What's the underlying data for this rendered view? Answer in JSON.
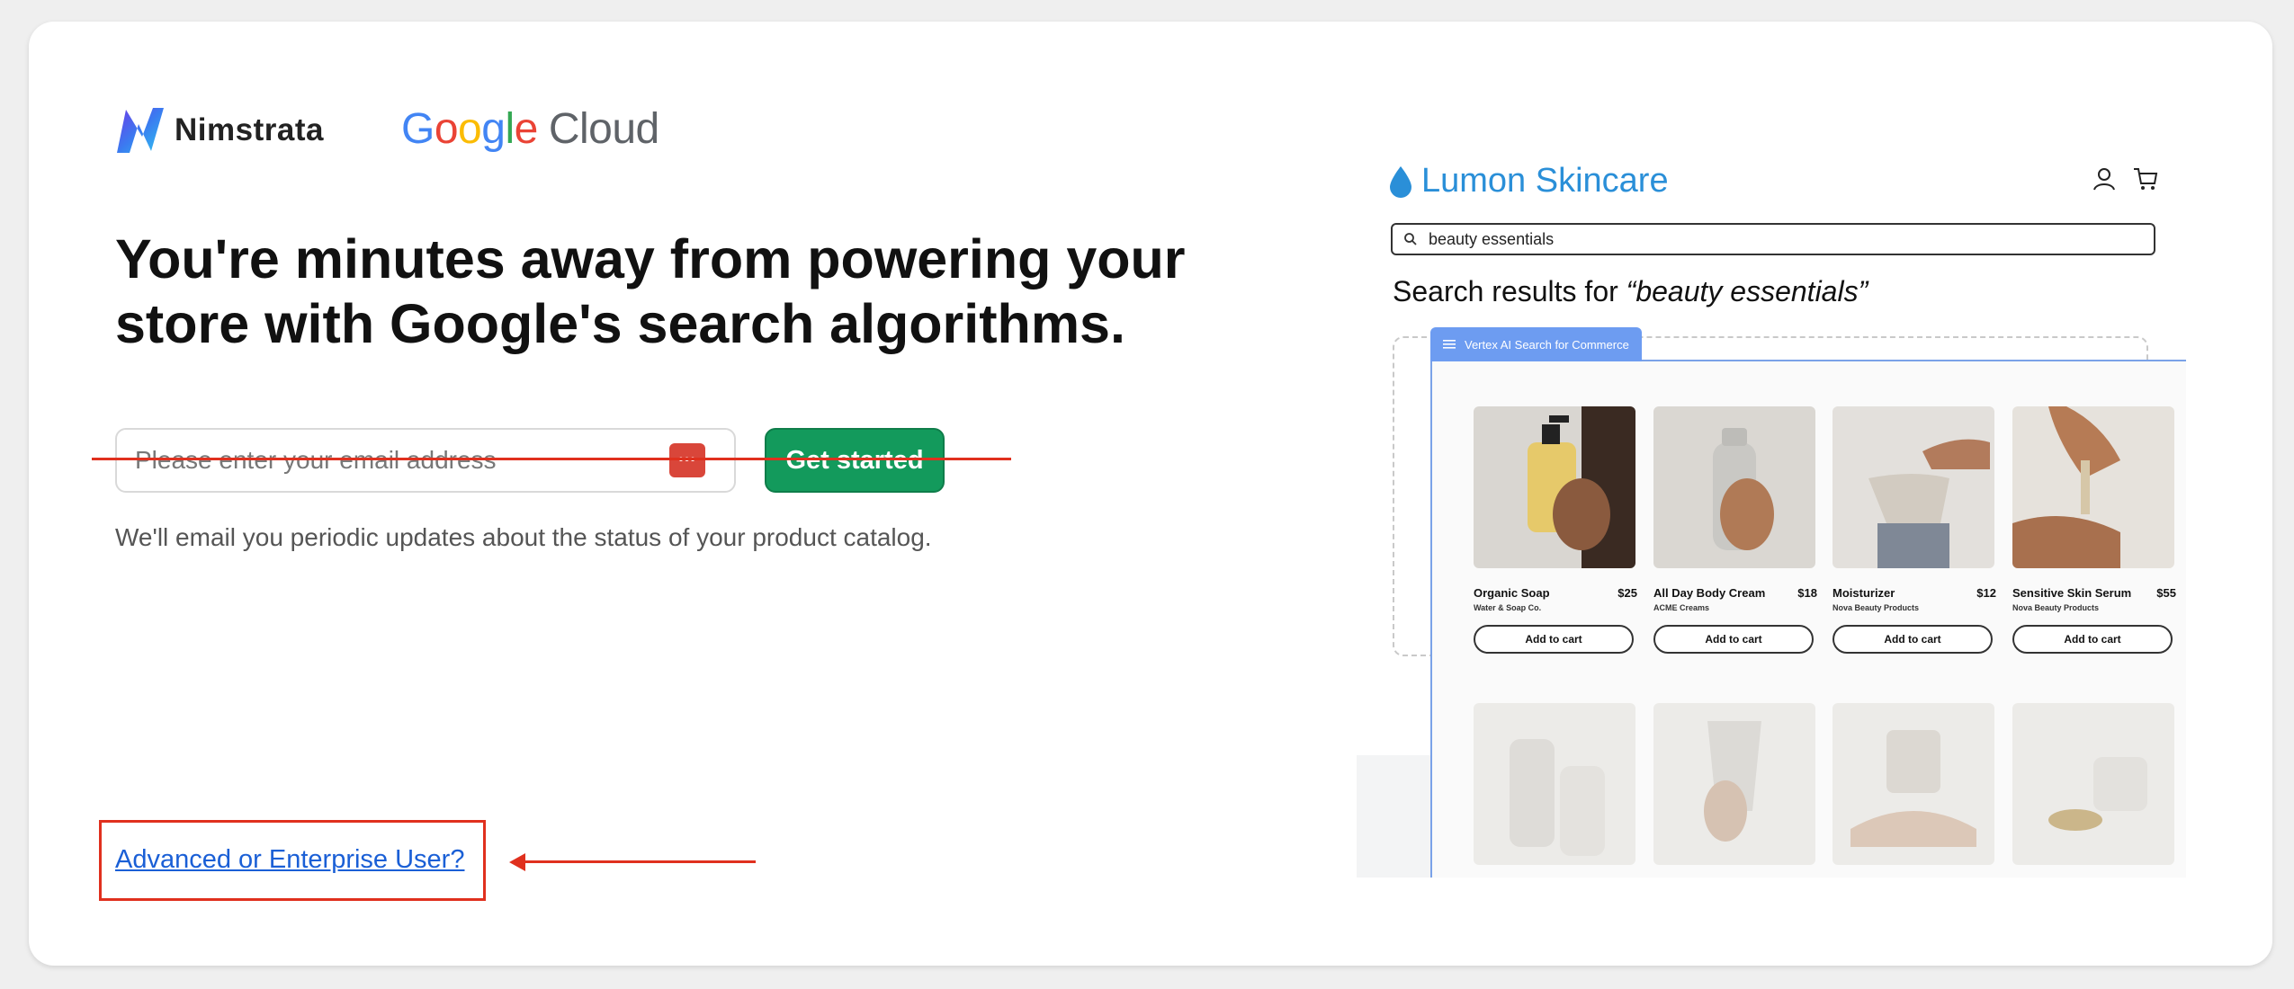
{
  "logos": {
    "nimstrata": "Nimstrata",
    "google_cloud": {
      "letters": [
        "G",
        "o",
        "o",
        "g",
        "l",
        "e"
      ],
      "colors": [
        "#4285F4",
        "#EA4335",
        "#FBBC05",
        "#4285F4",
        "#34A853",
        "#EA4335"
      ],
      "cloud": "Cloud"
    }
  },
  "headline": "You're minutes away from powering your store with Google's search algorithms.",
  "email": {
    "placeholder": "Please enter your email address",
    "value": "",
    "badge": "•••"
  },
  "get_started_label": "Get started",
  "note": "We'll email you periodic updates about the status of your product catalog.",
  "advanced_link": "Advanced or Enterprise User?",
  "annotation_color": "#e0301e",
  "preview": {
    "shop_name": "Lumon Skincare",
    "search_query": "beauty essentials",
    "results_prefix": "Search results for ",
    "results_query": "“beauty essentials”",
    "vertex_tab": "Vertex AI Search for Commerce",
    "products": [
      {
        "name": "Organic Soap",
        "price": "$25",
        "brand": "Water & Soap Co.",
        "cta": "Add to cart"
      },
      {
        "name": "All Day Body Cream",
        "price": "$18",
        "brand": "ACME Creams",
        "cta": "Add to cart"
      },
      {
        "name": "Moisturizer",
        "price": "$12",
        "brand": "Nova Beauty Products",
        "cta": "Add to cart"
      },
      {
        "name": "Sensitive Skin Serum",
        "price": "$55",
        "brand": "Nova Beauty Products",
        "cta": "Add to cart"
      }
    ]
  }
}
